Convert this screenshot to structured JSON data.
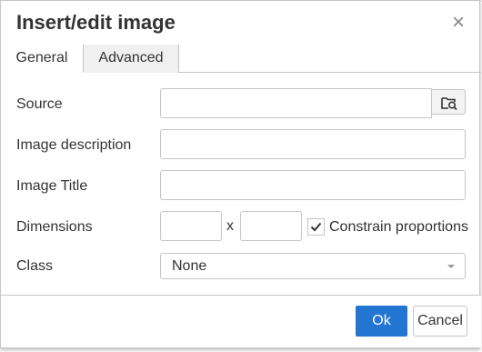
{
  "dialog": {
    "title": "Insert/edit image",
    "close_symbol": "×"
  },
  "tabs": [
    {
      "label": "General",
      "active": true
    },
    {
      "label": "Advanced",
      "active": false
    }
  ],
  "form": {
    "source": {
      "label": "Source",
      "value": "",
      "browse_icon": "folder-search-icon"
    },
    "description": {
      "label": "Image description",
      "value": ""
    },
    "title": {
      "label": "Image Title",
      "value": ""
    },
    "dimensions": {
      "label": "Dimensions",
      "width": "",
      "height": "",
      "separator": "x",
      "constrain_label": "Constrain proportions",
      "constrain_checked": true
    },
    "class": {
      "label": "Class",
      "selected": "None"
    }
  },
  "buttons": {
    "ok": "Ok",
    "cancel": "Cancel"
  },
  "colors": {
    "primary": "#2276d2",
    "border": "#c5c5c5"
  }
}
